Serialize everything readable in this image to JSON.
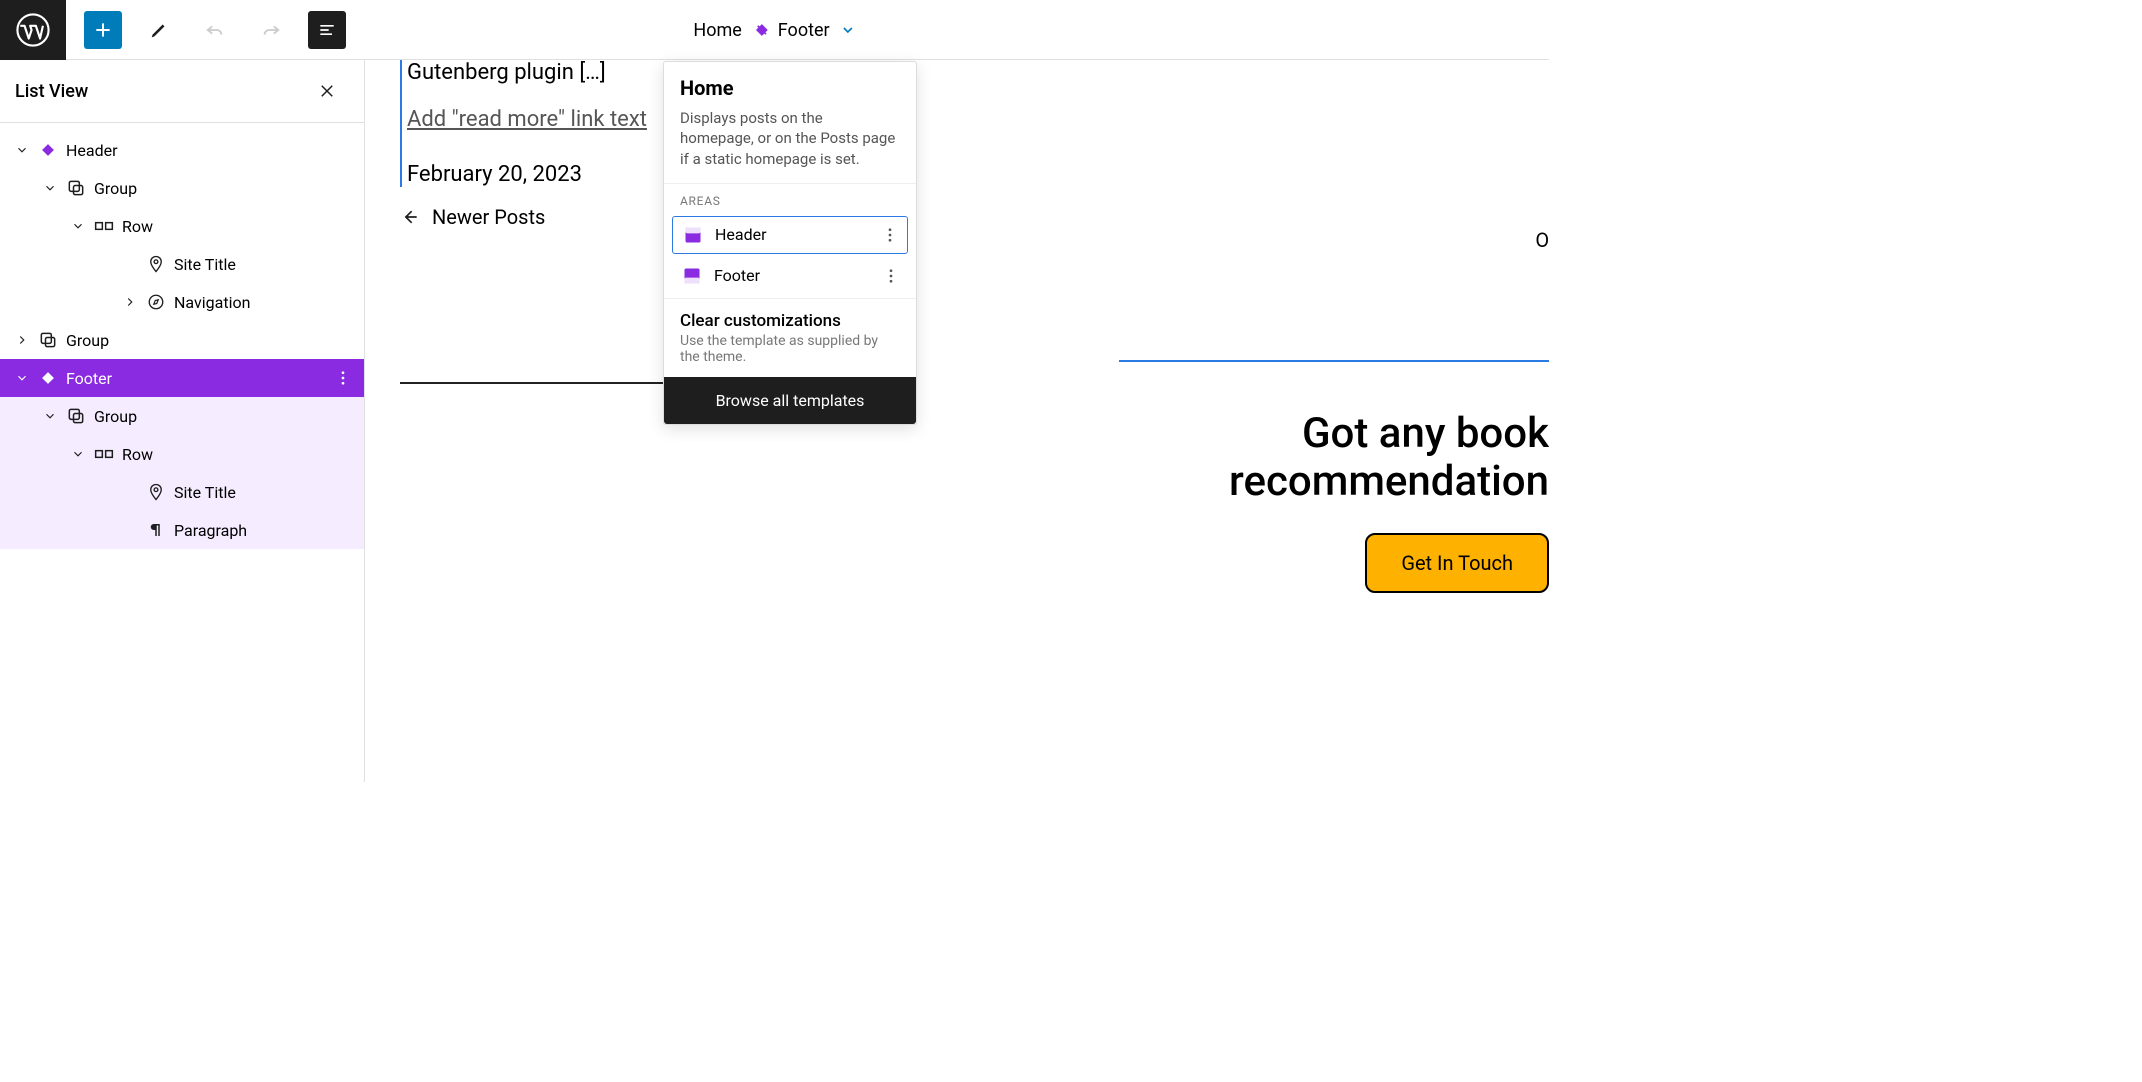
{
  "breadcrumb": {
    "home": "Home",
    "footer": "Footer"
  },
  "sidebar": {
    "title": "List View",
    "tree": [
      {
        "label": "Header",
        "depth": 0,
        "chev": "down",
        "icon": "diamond-purple"
      },
      {
        "label": "Group",
        "depth": 1,
        "chev": "down",
        "icon": "group"
      },
      {
        "label": "Row",
        "depth": 2,
        "chev": "down",
        "icon": "row"
      },
      {
        "label": "Site Title",
        "depth": 3,
        "chev": "",
        "icon": "pin"
      },
      {
        "label": "Navigation",
        "depth": 3,
        "chev": "right",
        "icon": "compass"
      },
      {
        "label": "Group",
        "depth": 0,
        "chev": "right",
        "icon": "group"
      },
      {
        "label": "Footer",
        "depth": 0,
        "chev": "down",
        "icon": "diamond-white",
        "selected": true
      },
      {
        "label": "Group",
        "depth": 1,
        "chev": "down",
        "icon": "group",
        "sub": true
      },
      {
        "label": "Row",
        "depth": 2,
        "chev": "down",
        "icon": "row",
        "sub": true
      },
      {
        "label": "Site Title",
        "depth": 3,
        "chev": "",
        "icon": "pin",
        "sub": true
      },
      {
        "label": "Paragraph",
        "depth": 3,
        "chev": "",
        "icon": "para",
        "sub": true
      }
    ]
  },
  "canvas": {
    "post_title": "Gutenberg plugin […]",
    "read_more": "Add \"read more\" link text",
    "post_date": "February 20, 2023",
    "newer": "Newer Posts",
    "old": "Ol",
    "footer_heading_1": "Got any book",
    "footer_heading_2": "recommendation",
    "button": "Get In Touch"
  },
  "dropdown": {
    "title": "Home",
    "desc": "Displays posts on the homepage, or on the Posts page if a static homepage is set.",
    "areas_label": "AREAS",
    "areas": [
      {
        "label": "Header",
        "selected": true
      },
      {
        "label": "Footer",
        "selected": false
      }
    ],
    "clear_title": "Clear customizations",
    "clear_desc": "Use the template as supplied by the theme.",
    "browse": "Browse all templates"
  },
  "colors": {
    "accent": "#8a2be2",
    "blue": "#007cba"
  }
}
